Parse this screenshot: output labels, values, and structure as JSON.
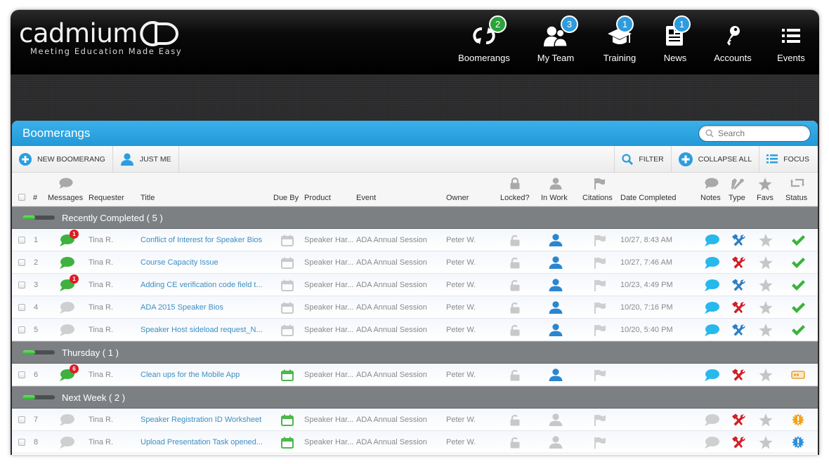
{
  "app": {
    "logo_text": "cadmium",
    "logo_mark": "CD",
    "tagline": "Meeting Education Made Easy"
  },
  "nav": [
    {
      "label": "Boomerangs",
      "icon": "refresh-icon",
      "badge": "2",
      "badge_color": "#2aa33a"
    },
    {
      "label": "My Team",
      "icon": "team-icon",
      "badge": "3",
      "badge_color": "#2f9bdc"
    },
    {
      "label": "Training",
      "icon": "graduation-cap-icon",
      "badge": "1",
      "badge_color": "#2f9bdc"
    },
    {
      "label": "News",
      "icon": "newspaper-icon",
      "badge": "1",
      "badge_color": "#2f9bdc"
    },
    {
      "label": "Accounts",
      "icon": "key-icon",
      "badge": null
    },
    {
      "label": "Events",
      "icon": "list-icon",
      "badge": null
    }
  ],
  "panel": {
    "title": "Boomerangs",
    "search_placeholder": "Search"
  },
  "toolbar": {
    "new_boomerang": "NEW BOOMERANG",
    "just_me": "JUST ME",
    "filter": "FILTER",
    "collapse_all": "COLLAPSE ALL",
    "focus": "FOCUS"
  },
  "columns": {
    "num": "#",
    "messages": "Messages",
    "requester": "Requester",
    "title": "Title",
    "due_by": "Due By",
    "product": "Product",
    "event": "Event",
    "owner": "Owner",
    "locked": "Locked?",
    "in_work": "In Work",
    "citations": "Citations",
    "date_completed": "Date Completed",
    "notes": "Notes",
    "type": "Type",
    "favs": "Favs",
    "status": "Status"
  },
  "colors": {
    "accent": "#2aa0df",
    "link": "#3d8fc1",
    "group_bg": "#7d8083",
    "done_green": "#3bb33b",
    "type_blue": "#2d7fc4",
    "type_red": "#d11f26",
    "status_orange": "#f2a31b",
    "status_blue": "#2d8fd8"
  },
  "groups": [
    {
      "label": "Recently Completed ( 5 )",
      "progress": 0.4,
      "rows": [
        {
          "num": "1",
          "msg_state": "active",
          "msg_badge": "1",
          "requester": "Tina R.",
          "title": "Conflict of Interest for Speaker Bios",
          "due_state": "gray",
          "product": "Speaker Har...",
          "event": "ADA Annual Session",
          "owner": "Peter W.",
          "in_work": true,
          "date_completed": "10/27, 8:43 AM",
          "notes": true,
          "type": "blue",
          "status": "done"
        },
        {
          "num": "2",
          "msg_state": "active",
          "msg_badge": null,
          "requester": "Tina R.",
          "title": "Course Capacity Issue",
          "due_state": "gray",
          "product": "Speaker Har...",
          "event": "ADA Annual Session",
          "owner": "Peter W.",
          "in_work": true,
          "date_completed": "10/27, 7:46 AM",
          "notes": true,
          "type": "red",
          "status": "done"
        },
        {
          "num": "3",
          "msg_state": "active",
          "msg_badge": "1",
          "requester": "Tina R.",
          "title": "Adding CE verification code field t...",
          "due_state": "gray",
          "product": "Speaker Har...",
          "event": "ADA Annual Session",
          "owner": "Peter W.",
          "in_work": true,
          "date_completed": "10/23, 4:49 PM",
          "notes": true,
          "type": "blue",
          "status": "done"
        },
        {
          "num": "4",
          "msg_state": "none",
          "msg_badge": null,
          "requester": "Tina R.",
          "title": "ADA 2015 Speaker Bios",
          "due_state": "gray",
          "product": "Speaker Har...",
          "event": "ADA Annual Session",
          "owner": "Peter W.",
          "in_work": true,
          "date_completed": "10/20, 7:16 PM",
          "notes": true,
          "type": "red",
          "status": "done"
        },
        {
          "num": "5",
          "msg_state": "none",
          "msg_badge": null,
          "requester": "Tina R.",
          "title": "Speaker Host sideload request_N...",
          "due_state": "gray",
          "product": "Speaker Har...",
          "event": "ADA Annual Session",
          "owner": "Peter W.",
          "in_work": true,
          "date_completed": "10/20, 5:40 PM",
          "notes": true,
          "type": "blue",
          "status": "done"
        }
      ]
    },
    {
      "label": "Thursday ( 1 )",
      "progress": 0.4,
      "rows": [
        {
          "num": "6",
          "msg_state": "active",
          "msg_badge": "6",
          "requester": "Tina R.",
          "title": "Clean ups for the Mobile App",
          "due_state": "green",
          "product": "Speaker Har...",
          "event": "ADA Annual Session",
          "owner": "Peter W.",
          "in_work": true,
          "date_completed": "",
          "notes": true,
          "type": "red",
          "status": "in-progress"
        }
      ]
    },
    {
      "label": "Next Week ( 2 )",
      "progress": 0.4,
      "rows": [
        {
          "num": "7",
          "msg_state": "none",
          "msg_badge": null,
          "requester": "Tina R.",
          "title": "Speaker Registration ID Worksheet",
          "due_state": "green",
          "product": "Speaker Har...",
          "event": "ADA Annual Session",
          "owner": "Peter W.",
          "in_work": false,
          "date_completed": "",
          "notes": false,
          "type": "red",
          "status": "alert-orange"
        },
        {
          "num": "8",
          "msg_state": "none",
          "msg_badge": null,
          "requester": "Tina R.",
          "title": "Upload Presentation Task opened...",
          "due_state": "green",
          "product": "Speaker Har...",
          "event": "ADA Annual Session",
          "owner": "Peter W.",
          "in_work": false,
          "date_completed": "",
          "notes": false,
          "type": "red",
          "status": "alert-blue"
        }
      ]
    }
  ]
}
